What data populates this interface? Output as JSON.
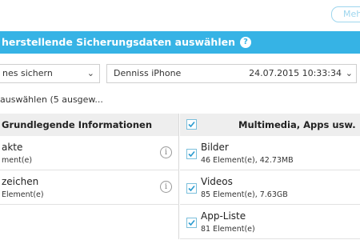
{
  "toolbar": {
    "more_label": "Meh"
  },
  "banner": {
    "title": "herstellende Sicherungsdaten auswählen",
    "help_icon": "?"
  },
  "selectors": {
    "left": {
      "value": "nes sichern"
    },
    "right": {
      "device": "Denniss iPhone",
      "date": "24.07.2015 10:33:34"
    }
  },
  "select_all": {
    "label": "auswählen (5 ausgew..."
  },
  "columns": {
    "left": {
      "title": "Grundlegende Informationen"
    },
    "right": {
      "title": "Multimedia, Apps usw."
    }
  },
  "left_items": [
    {
      "title": "akte",
      "sub": "ment(e)"
    },
    {
      "title": "zeichen",
      "sub": "Element(e)"
    }
  ],
  "right_items": [
    {
      "title": "Bilder",
      "sub": "46 Element(e), 42.73MB"
    },
    {
      "title": "Videos",
      "sub": "85 Element(e), 7.63GB"
    },
    {
      "title": "App-Liste",
      "sub": "81 Element(e)"
    }
  ],
  "colors": {
    "accent": "#36b3e5",
    "header_bg": "#eeeeee"
  },
  "icons": {
    "info": "info-icon",
    "help": "help-icon",
    "dropdown": "chevron-down-icon",
    "check": "checkmark-icon"
  }
}
